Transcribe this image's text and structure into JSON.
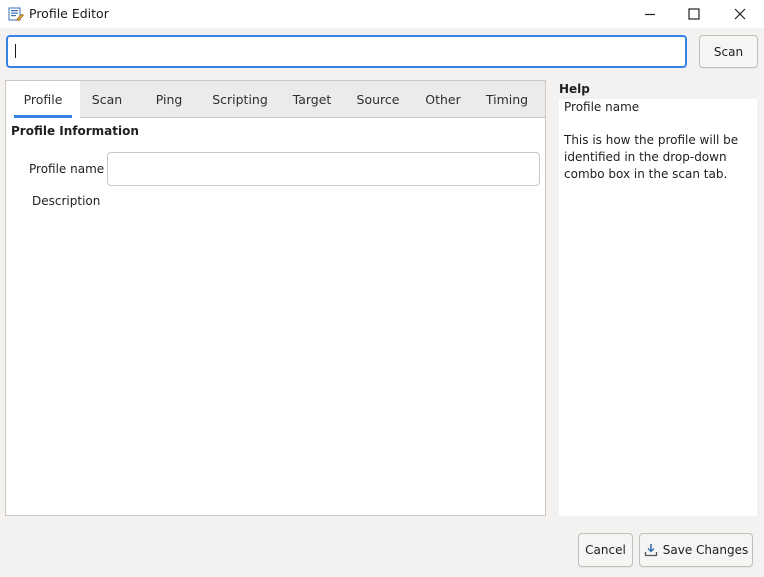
{
  "window": {
    "title": "Profile Editor",
    "icons": {
      "app": "profile-editor-icon",
      "minimize": "minimize-icon",
      "maximize": "maximize-icon",
      "close": "close-icon"
    }
  },
  "command": {
    "value": "",
    "scan_label": "Scan"
  },
  "tabs": [
    {
      "label": "Profile",
      "active": true
    },
    {
      "label": "Scan",
      "active": false
    },
    {
      "label": "Ping",
      "active": false
    },
    {
      "label": "Scripting",
      "active": false
    },
    {
      "label": "Target",
      "active": false
    },
    {
      "label": "Source",
      "active": false
    },
    {
      "label": "Other",
      "active": false
    },
    {
      "label": "Timing",
      "active": false
    }
  ],
  "profile": {
    "section_title": "Profile Information",
    "name_label": "Profile name",
    "name_value": "",
    "description_label": "Description"
  },
  "help": {
    "title": "Help",
    "heading": "Profile name",
    "body": "This is how the profile will be identified in the drop-down combo box in the scan tab."
  },
  "buttons": {
    "cancel": "Cancel",
    "save": "Save Changes",
    "save_icon": "save-icon"
  },
  "colors": {
    "accent": "#3584e4",
    "window_bg": "#f3f2f1",
    "tab_strip": "#ebebeb"
  }
}
